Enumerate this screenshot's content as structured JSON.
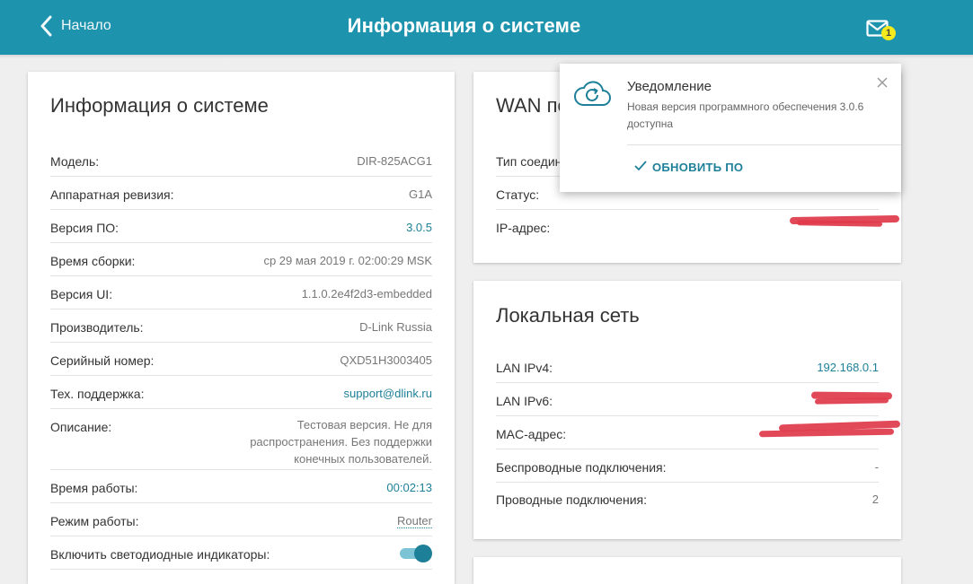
{
  "header": {
    "back_label": "Начало",
    "title": "Информация о системе",
    "mail_count": "1"
  },
  "system_info": {
    "title": "Информация о системе",
    "rows": [
      {
        "label": "Модель:",
        "value": "DIR-825ACG1"
      },
      {
        "label": "Аппаратная ревизия:",
        "value": "G1A"
      },
      {
        "label": "Версия ПО:",
        "value": "3.0.5"
      },
      {
        "label": "Время сборки:",
        "value": "ср 29 мая 2019 г. 02:00:29 MSK"
      },
      {
        "label": "Версия UI:",
        "value": "1.1.0.2e4f2d3-embedded"
      },
      {
        "label": "Производитель:",
        "value": "D-Link Russia"
      },
      {
        "label": "Серийный номер:",
        "value": "QXD51H3003405"
      },
      {
        "label": "Тех. поддержка:",
        "value": "support@dlink.ru"
      },
      {
        "label": "Описание:",
        "value": "Тестовая версия. Не для распространения. Без поддержки конечных пользователей."
      },
      {
        "label": "Время работы:",
        "value": "00:02:13"
      },
      {
        "label": "Режим работы:",
        "value": "Router"
      },
      {
        "label": "Включить светодиодные индикаторы:",
        "value": ""
      }
    ],
    "led_enabled": true
  },
  "wan": {
    "title": "WAN по",
    "rows": [
      {
        "label": "Тип соедин",
        "value": ""
      },
      {
        "label": "Статус:",
        "value": ""
      },
      {
        "label": "IP-адрес:",
        "value": ""
      }
    ]
  },
  "lan": {
    "title": "Локальная сеть",
    "rows": [
      {
        "label": "LAN IPv4:",
        "value": "192.168.0.1"
      },
      {
        "label": "LAN IPv6:",
        "value": ""
      },
      {
        "label": "MAC-адрес:",
        "value": ""
      },
      {
        "label": "Беспроводные подключения:",
        "value": "-"
      },
      {
        "label": "Проводные подключения:",
        "value": "2"
      }
    ]
  },
  "notification": {
    "title": "Уведомление",
    "text": "Новая версия программного обеспечения 3.0.6 доступна",
    "action_label": "ОБНОВИТЬ ПО"
  },
  "colors": {
    "header": "#1e93ad",
    "accent": "#1e7f99",
    "badge": "#f5ea1b",
    "redaction": "#e0394a"
  }
}
